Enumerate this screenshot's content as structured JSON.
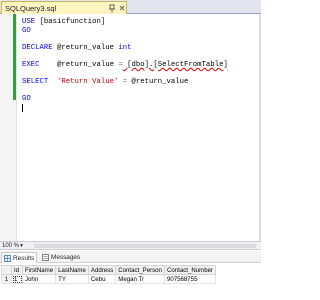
{
  "document_tab": {
    "title": "SQLQuery3.sql"
  },
  "editor": {
    "lines": [
      {
        "kw": "USE",
        "rest": " [basicfunction]"
      },
      {
        "kw": "GO"
      },
      {
        "blank": true
      },
      {
        "kw": "DECLARE",
        "rest": " @return_value ",
        "kw2": "int"
      },
      {
        "blank": true
      },
      {
        "kw": "EXEC",
        "rest": "    @return_value ",
        "op": "=",
        "ident": " [dbo].[SelectFromTable]"
      },
      {
        "blank": true
      },
      {
        "kw": "SELECT",
        "str": "  'Return Value'",
        "op": " =",
        "rest": " @return_value"
      },
      {
        "blank": true
      },
      {
        "kw": "GO"
      }
    ]
  },
  "status": {
    "zoom": "100 %"
  },
  "results": {
    "tabs": [
      {
        "label": "Results",
        "active": true,
        "icon": "grid-icon"
      },
      {
        "label": "Messages",
        "active": false,
        "icon": "messages-icon"
      }
    ],
    "columns": [
      "Id",
      "FirstName",
      "LastName",
      "Address",
      "Contact_Person",
      "Contact_Number"
    ],
    "rows": [
      {
        "num": "1",
        "cells": [
          "1",
          "John",
          "TY",
          "Cebu",
          "Megan Tr",
          "907568755"
        ]
      }
    ]
  },
  "colors": {
    "keyword": "#0000ff",
    "string": "#c00000",
    "operator": "#808080",
    "tab_highlight": "#fdf4bf"
  }
}
